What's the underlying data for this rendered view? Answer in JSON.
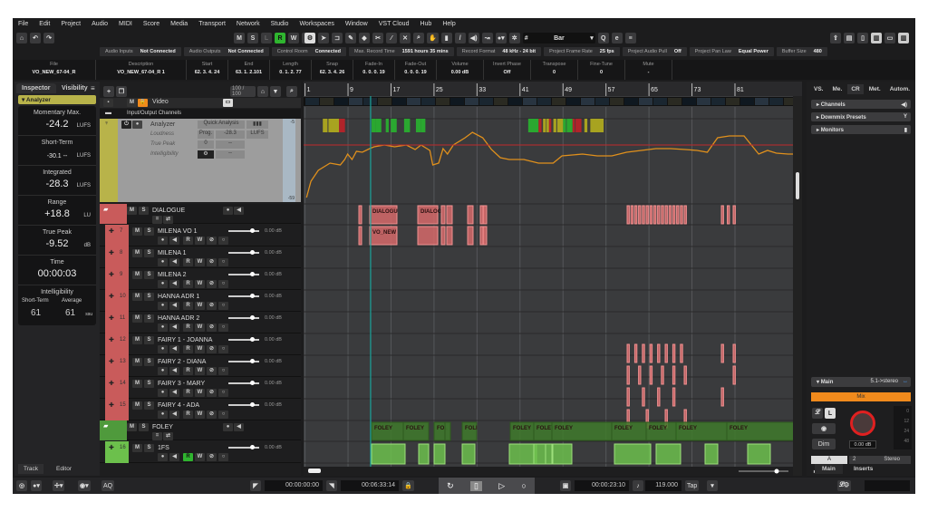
{
  "menu": [
    "File",
    "Edit",
    "Project",
    "Audio",
    "MIDI",
    "Score",
    "Media",
    "Transport",
    "Network",
    "Studio",
    "Workspaces",
    "Window",
    "VST Cloud",
    "Hub",
    "Help"
  ],
  "toolbar": {
    "modes": [
      "M",
      "S",
      "L",
      "R",
      "W",
      "A"
    ],
    "snap_type": "Bar"
  },
  "status": [
    {
      "label": "Audio Inputs",
      "value": "Not Connected"
    },
    {
      "label": "Audio Outputs",
      "value": "Not Connected"
    },
    {
      "label": "Control Room",
      "value": "Connected"
    },
    {
      "label": "Max. Record Time",
      "value": "1591 hours 35 mins"
    },
    {
      "label": "Record Format",
      "value": "48 kHz - 24 bit"
    },
    {
      "label": "Project Frame Rate",
      "value": "25 fps"
    },
    {
      "label": "Project Audio Pull",
      "value": "Off"
    },
    {
      "label": "Project Pan Law",
      "value": "Equal Power"
    },
    {
      "label": "Buffer Size",
      "value": "480"
    }
  ],
  "info": [
    {
      "label": "File",
      "value": "VO_NEW_67-04_R"
    },
    {
      "label": "Description",
      "value": "VO_NEW_67-04_R 1"
    },
    {
      "label": "Start",
      "value": "62. 3. 4. 24"
    },
    {
      "label": "End",
      "value": "63. 1. 2.101"
    },
    {
      "label": "Length",
      "value": "0. 1. 2. 77"
    },
    {
      "label": "Snap",
      "value": "62. 3. 4. 26"
    },
    {
      "label": "Fade-In",
      "value": "0. 0. 0. 19"
    },
    {
      "label": "Fade-Out",
      "value": "0. 0. 0. 19"
    },
    {
      "label": "Volume",
      "value": "0.00  dB"
    },
    {
      "label": "Invert Phase",
      "value": "Off"
    },
    {
      "label": "Transpose",
      "value": "0"
    },
    {
      "label": "Fine-Tune",
      "value": "0"
    },
    {
      "label": "Mute",
      "value": "-"
    }
  ],
  "inspector": {
    "tabs": [
      "Inspector",
      "Visibility"
    ],
    "section": "Analyzer",
    "meters": [
      {
        "title": "Momentary Max.",
        "value": "-24.2",
        "unit": "LUFS"
      },
      {
        "title": "Short-Term",
        "value": "-30.1    --",
        "unit": "LUFS"
      },
      {
        "title": "Integrated",
        "value": "-28.3",
        "unit": "LUFS"
      },
      {
        "title": "Range",
        "value": "+18.8",
        "unit": "LU"
      },
      {
        "title": "True Peak",
        "value": "-9.52",
        "unit": "dB"
      },
      {
        "title": "Time",
        "value": "00:00:03",
        "unit": ""
      }
    ],
    "intelligibility": {
      "title": "Intelligibility",
      "short_label": "Short-Term",
      "avg_label": "Average",
      "short": "61",
      "avg": "61",
      "unit": "ssu"
    },
    "bottom_tabs": [
      "Track",
      "Editor"
    ]
  },
  "tracklist": {
    "zoom": "100 / 100",
    "video": "Video",
    "io_folder": "Input/Output Channels",
    "analyzer": {
      "name": "Analyzer",
      "quick": "Quick Analysis",
      "rows": [
        "Loudness",
        "True Peak",
        "Intelligibility"
      ],
      "prog": "Prog.",
      "value": "-28.3",
      "unit": "LUFS",
      "dash": "--",
      "scale_top": "-5",
      "scale_bottom": "-59"
    },
    "dialogue_folder": "DIALOGUE",
    "foley_folder": "FOLEY",
    "tracks": [
      {
        "num": "7",
        "name": "MILENA VO 1",
        "vol": "0.00 dB"
      },
      {
        "num": "8",
        "name": "MILENA 1",
        "vol": "0.00 dB"
      },
      {
        "num": "9",
        "name": "MILENA 2",
        "vol": "0.00 dB"
      },
      {
        "num": "10",
        "name": "HANNA ADR 1",
        "vol": "0.00 dB"
      },
      {
        "num": "11",
        "name": "HANNA ADR 2",
        "vol": "0.00 dB"
      },
      {
        "num": "12",
        "name": "FAIRY 1 - JOANNA",
        "vol": "0.00 dB"
      },
      {
        "num": "13",
        "name": "FAIRY 2 - DIANA",
        "vol": "0.00 dB"
      },
      {
        "num": "14",
        "name": "FAIRY 3 - MARY",
        "vol": "0.00 dB"
      },
      {
        "num": "15",
        "name": "FAIRY 4 - ADA",
        "vol": "0.00 dB"
      }
    ],
    "foley_track": {
      "num": "16",
      "name": "1FS",
      "vol": "0.00 dB"
    }
  },
  "ruler": [
    "1",
    "9",
    "17",
    "25",
    "33",
    "41",
    "49",
    "57",
    "65",
    "73",
    "81"
  ],
  "clips": {
    "dialogue": [
      "DIALOGU",
      "DIALOG"
    ],
    "vo": "VO_NEW",
    "foley": [
      "FOLEY",
      "FOLEY",
      "FOL",
      "FOLI",
      "FOLEY",
      "FOLEY",
      "FOLEY",
      "FOLEY",
      "FOLEY",
      "FOLEY",
      "FOLEY"
    ]
  },
  "right": {
    "tabs": [
      "VS.",
      "Me.",
      "CR",
      "Met.",
      "Autom."
    ],
    "sections": [
      "Channels",
      "Downmix Presets",
      "Monitors"
    ],
    "main": "Main",
    "main_format": "5.1->stereo",
    "mix": "Mix",
    "dim": "Dim",
    "level": "0.00 dB",
    "outputs": [
      "A",
      "2",
      "Stereo"
    ],
    "levels": "Levels",
    "scale": [
      "0",
      "12",
      "24",
      "48"
    ],
    "bottom_tabs": [
      "Main",
      "Inserts"
    ]
  },
  "transport": {
    "aq": "AQ",
    "left_locator": "00:00:00:00",
    "right_locator": "00:06:33:14",
    "position": "00:00:23:10",
    "tempo": "119.000",
    "tap": "Tap"
  },
  "colors": {
    "dialogue": "#c95b5b",
    "foley": "#4f9a3c",
    "analyzer": "#b8b34a",
    "loudness_curve": "#e0901c",
    "target_line": "#c0282a",
    "cursor": "#1aa39a",
    "mix": "#f08a1c"
  }
}
